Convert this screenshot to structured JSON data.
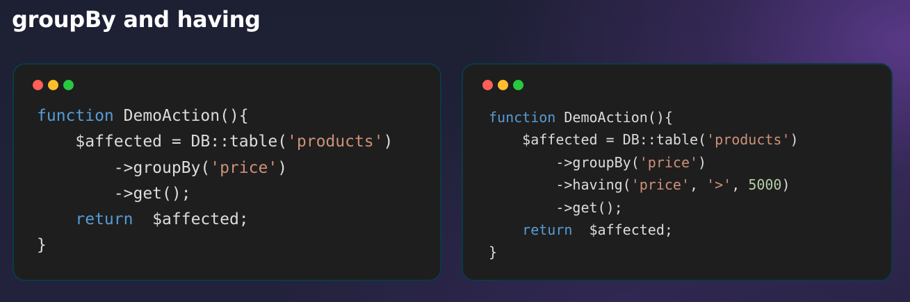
{
  "page": {
    "title": "groupBy and having"
  },
  "colors": {
    "keyword": "#569cd6",
    "string": "#ce9178",
    "number": "#b5cea8",
    "text": "#dcdcdc",
    "card_background": "#1e1e1e",
    "card_border": "#0b3a45",
    "dot_red": "#ff5f56",
    "dot_yellow": "#ffbd2e",
    "dot_green": "#27c93f"
  },
  "window_controls": [
    "red-dot-icon",
    "yellow-dot-icon",
    "green-dot-icon"
  ],
  "code_left": {
    "line1": {
      "kw": "function",
      "rest": " DemoAction(){"
    },
    "line2": {
      "indent": "    ",
      "pre": "$affected = DB::table(",
      "str": "'products'",
      "post": ")"
    },
    "line3": {
      "indent": "        ",
      "pre": "->groupBy(",
      "str": "'price'",
      "post": ")"
    },
    "line4": {
      "indent": "        ",
      "text": "->get();"
    },
    "line5": {
      "indent": "    ",
      "kw": "return",
      "rest": "  $affected;"
    },
    "line6": {
      "text": "}"
    }
  },
  "code_right": {
    "line1": {
      "kw": "function",
      "rest": " DemoAction(){"
    },
    "line2": {
      "indent": "    ",
      "pre": "$affected = DB::table(",
      "str": "'products'",
      "post": ")"
    },
    "line3": {
      "indent": "        ",
      "pre": "->groupBy(",
      "str": "'price'",
      "post": ")"
    },
    "line4": {
      "indent": "        ",
      "pre": "->having(",
      "str1": "'price'",
      "sep1": ", ",
      "str2": "'>'",
      "sep2": ", ",
      "num": "5000",
      "post": ")"
    },
    "line5": {
      "indent": "        ",
      "text": "->get();"
    },
    "line6": {
      "indent": "    ",
      "kw": "return",
      "rest": "  $affected;"
    },
    "line7": {
      "text": "}"
    }
  }
}
